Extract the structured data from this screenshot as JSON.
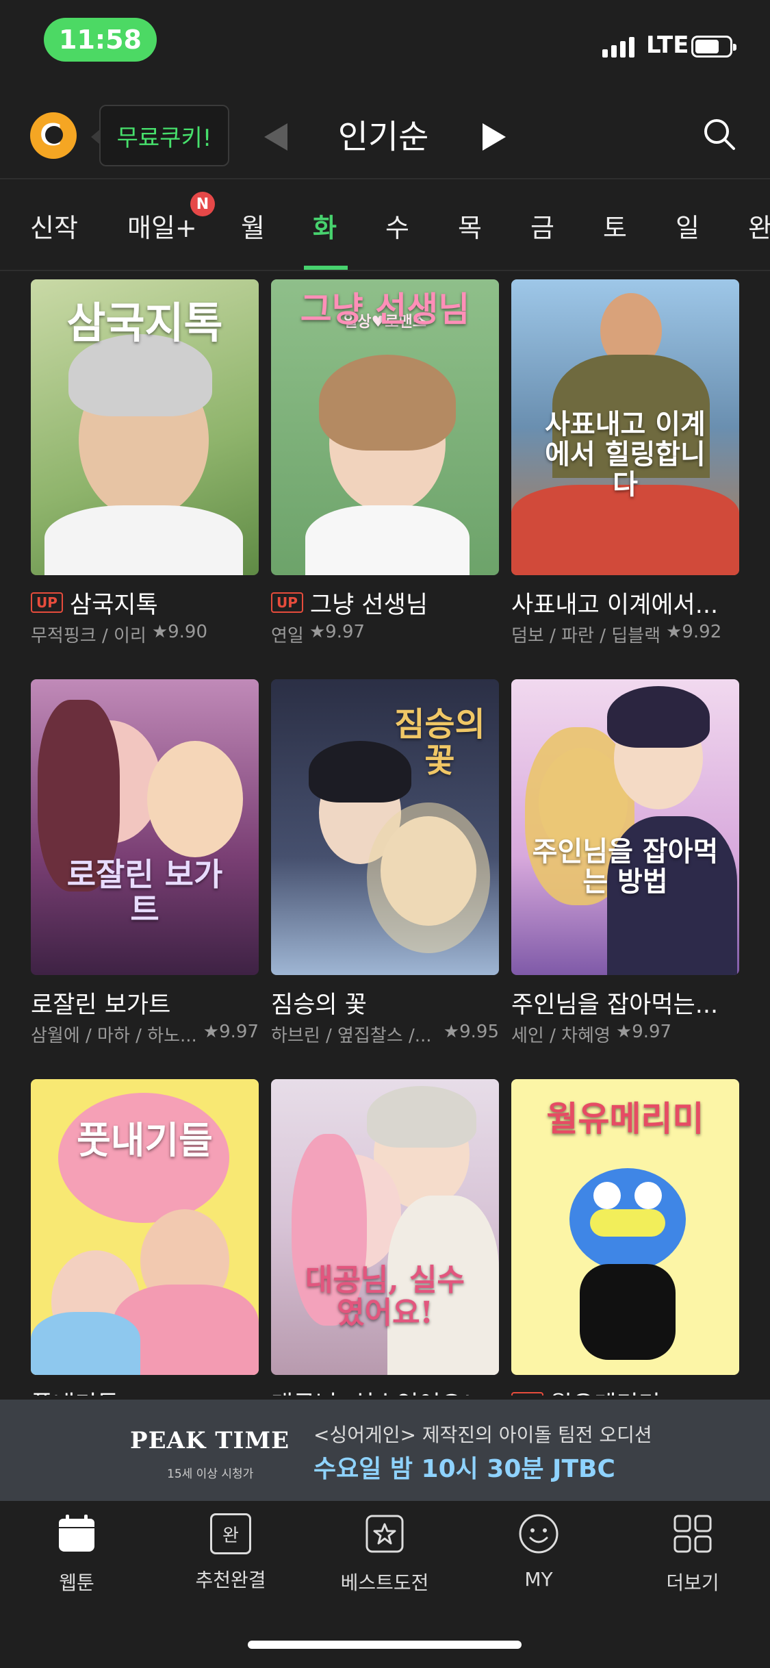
{
  "status": {
    "time": "11:58",
    "network": "LTE"
  },
  "header": {
    "logo_letter": "C",
    "cookie_label": "무료쿠키!",
    "sort_title": "인기순"
  },
  "days": [
    {
      "label": "신작"
    },
    {
      "label": "매일+",
      "badge": "N"
    },
    {
      "label": "월"
    },
    {
      "label": "화",
      "active": true
    },
    {
      "label": "수"
    },
    {
      "label": "목"
    },
    {
      "label": "금"
    },
    {
      "label": "토"
    },
    {
      "label": "일"
    },
    {
      "label": "완"
    }
  ],
  "comics": [
    {
      "title": "삼국지톡",
      "up": "UP",
      "author": "무적핑크 / 이리",
      "rating": "9.90",
      "cover_text": "삼국지톡"
    },
    {
      "title": "그냥 선생님",
      "up": "UP",
      "author": "연일",
      "rating": "9.97",
      "cover_text": "그냥 선생님",
      "cover_sub": "일상♥로맨스"
    },
    {
      "title": "사표내고 이계에서...",
      "author": "덤보 / 파란 / 딥블랙",
      "rating": "9.92",
      "cover_text": "사표내고 이계에서 힐링합니다"
    },
    {
      "title": "로잘린 보가트",
      "author": "삼월에 / 마하 / 하노...",
      "rating": "9.97",
      "cover_text": "로잘린 보가트"
    },
    {
      "title": "짐승의 꽃",
      "author": "하브린 / 옆집찰스 /...",
      "rating": "9.95",
      "cover_text": "짐승의 꽃"
    },
    {
      "title": "주인님을 잡아먹는...",
      "author": "세인 / 차혜영",
      "rating": "9.97",
      "cover_text": "주인님을 잡아먹는 방법"
    },
    {
      "title": "풋내기들",
      "cover_text": "풋내기들"
    },
    {
      "title": "대공님, 실수였어요!",
      "cover_text": "대공님, 실수였어요!"
    },
    {
      "title": "월유메리미",
      "up": "UP",
      "cover_text": "월유메리미"
    }
  ],
  "ad": {
    "logo": "PEAK TIME",
    "logo_sub": "15세 이상 시청가",
    "line1": "<싱어게인> 제작진의 아이돌 팀전 오디션",
    "line2": "수요일 밤 10시 30분 JTBC"
  },
  "tabbar": [
    {
      "label": "웹툰",
      "icon": "calendar-icon"
    },
    {
      "label": "추천완결",
      "icon": "book-icon",
      "glyph": "완"
    },
    {
      "label": "베스트도전",
      "icon": "star-box-icon"
    },
    {
      "label": "MY",
      "icon": "smile-icon"
    },
    {
      "label": "더보기",
      "icon": "grid-icon"
    }
  ],
  "colors": {
    "accent": "#47d26e",
    "background": "#1f1f1f",
    "up_badge": "#e74c3c"
  }
}
